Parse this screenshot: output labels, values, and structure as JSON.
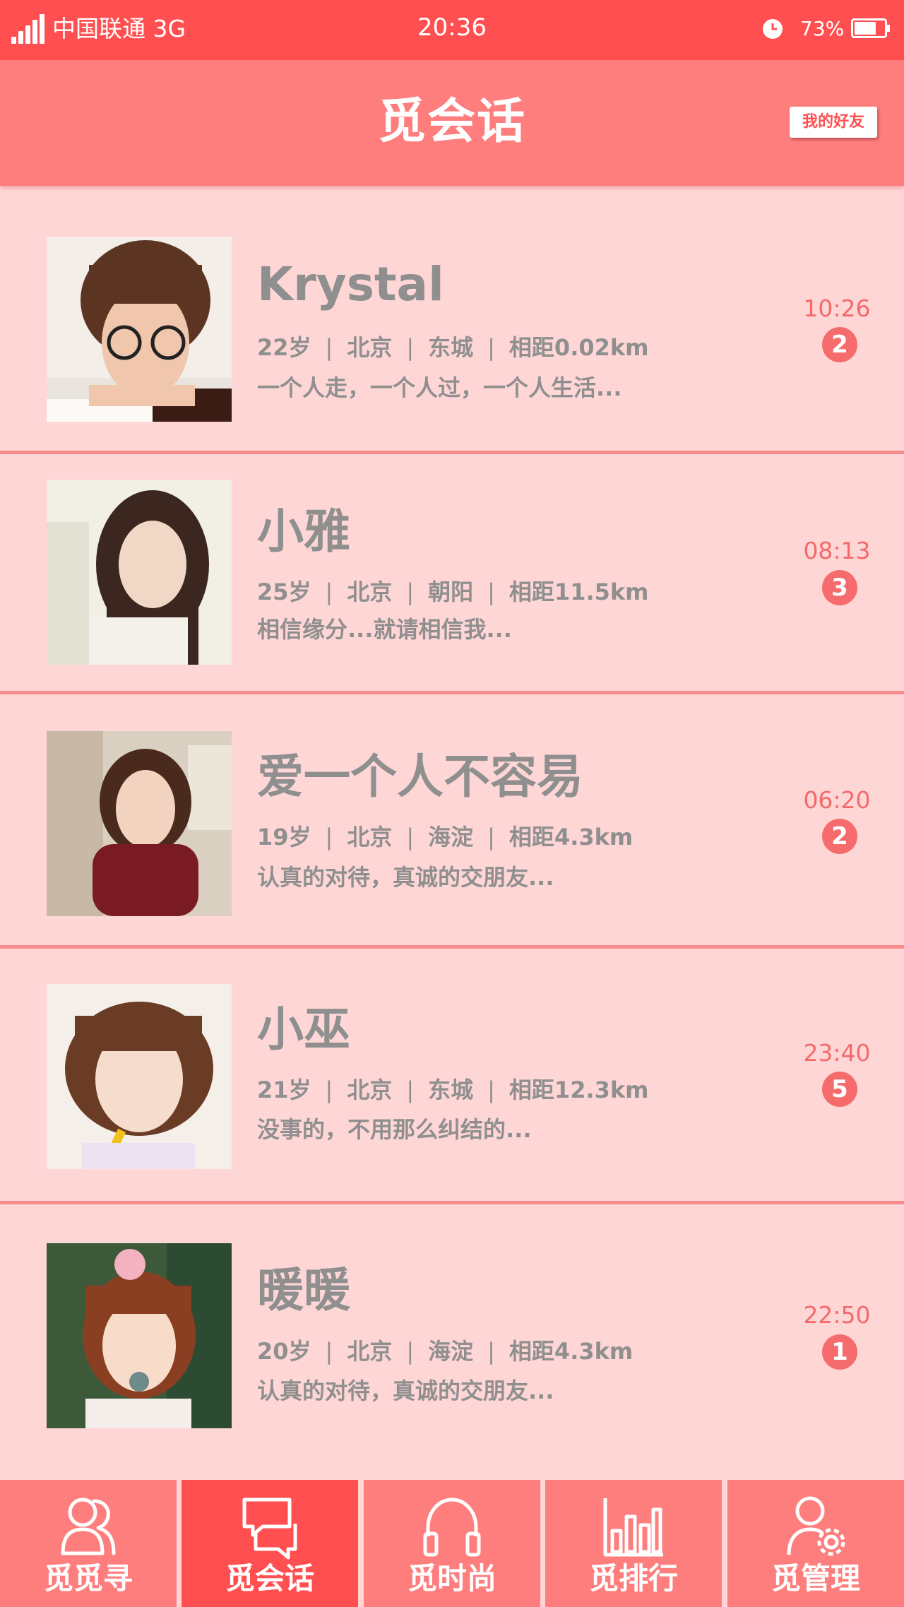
{
  "status_bar": {
    "carrier": "中国联通 3G",
    "time": "20:36",
    "battery_percent": "73%",
    "battery_level": 0.73
  },
  "header": {
    "title": "觅会话",
    "friends_button": "我的好友"
  },
  "conversations": [
    {
      "name": "Krystal",
      "age": "22岁",
      "city": "北京",
      "district": "东城",
      "distance": "相距0.02km",
      "message": "一个人走，一个人过，一个人生活...",
      "time": "10:26",
      "unread": "2"
    },
    {
      "name": "小雅",
      "age": "25岁",
      "city": "北京",
      "district": "朝阳",
      "distance": "相距11.5km",
      "message": "相信缘分...就请相信我...",
      "time": "08:13",
      "unread": "3"
    },
    {
      "name": "爱一个人不容易",
      "age": "19岁",
      "city": "北京",
      "district": "海淀",
      "distance": "相距4.3km",
      "message": "认真的对待，真诚的交朋友...",
      "time": "06:20",
      "unread": "2"
    },
    {
      "name": "小巫",
      "age": "21岁",
      "city": "北京",
      "district": "东城",
      "distance": "相距12.3km",
      "message": "没事的，不用那么纠结的...",
      "time": "23:40",
      "unread": "5"
    },
    {
      "name": "暖暖",
      "age": "20岁",
      "city": "北京",
      "district": "海淀",
      "distance": "相距4.3km",
      "message": "认真的对待，真诚的交朋友...",
      "time": "22:50",
      "unread": "1"
    }
  ],
  "separator": "|",
  "nav": [
    {
      "label": "觅觅寻",
      "icon": "users-icon",
      "active": false
    },
    {
      "label": "觅会话",
      "icon": "chat-bubbles-icon",
      "active": true
    },
    {
      "label": "觅时尚",
      "icon": "headphones-icon",
      "active": false
    },
    {
      "label": "觅排行",
      "icon": "bar-chart-icon",
      "active": false
    },
    {
      "label": "觅管理",
      "icon": "user-settings-icon",
      "active": false
    }
  ],
  "colors": {
    "status_bar": "#ff4f50",
    "header": "#fe7e7e",
    "list_background": "#ffd6d6",
    "divider": "#f78c8c",
    "text_gray": "#8f8f8f",
    "time_red": "#f36a6a",
    "badge": "#f66c6c",
    "nav_active": "#ff4f50"
  }
}
